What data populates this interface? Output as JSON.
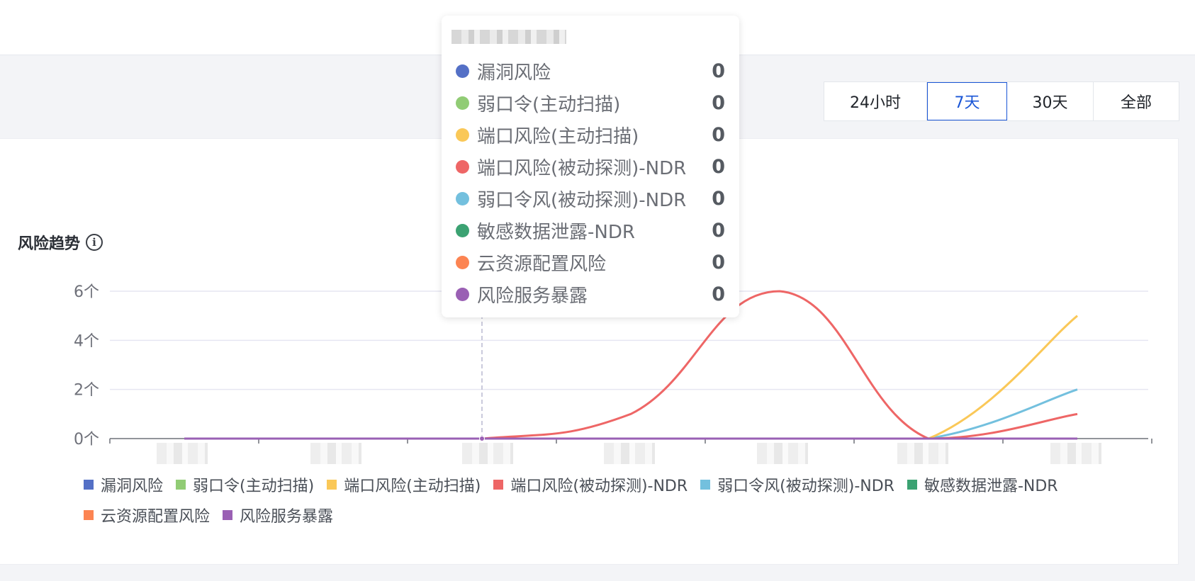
{
  "range_buttons": [
    {
      "label": "24小时",
      "active": false
    },
    {
      "label": "7天",
      "active": true
    },
    {
      "label": "30天",
      "active": false
    },
    {
      "label": "全部",
      "active": false
    }
  ],
  "chart_title": "风险趋势",
  "info_icon": "info-icon",
  "tooltip": {
    "rows": [
      {
        "label": "漏洞风险",
        "value": "0",
        "color": "#5470c6"
      },
      {
        "label": "弱口令(主动扫描)",
        "value": "0",
        "color": "#91cc75"
      },
      {
        "label": "端口风险(主动扫描)",
        "value": "0",
        "color": "#fac858"
      },
      {
        "label": "端口风险(被动探测)-NDR",
        "value": "0",
        "color": "#ee6666"
      },
      {
        "label": "弱口令风(被动探测)-NDR",
        "value": "0",
        "color": "#73c0de"
      },
      {
        "label": "敏感数据泄露-NDR",
        "value": "0",
        "color": "#3ba272"
      },
      {
        "label": "云资源配置风险",
        "value": "0",
        "color": "#fc8452"
      },
      {
        "label": "风险服务暴露",
        "value": "0",
        "color": "#9a60b4"
      }
    ]
  },
  "chart_data": {
    "type": "line",
    "smooth": true,
    "x_points": 7,
    "x_labels_obscured": true,
    "y_ticks": [
      "0个",
      "2个",
      "4个",
      "6个"
    ],
    "ylim": [
      0,
      6
    ],
    "grid": true,
    "legend_position": "bottom",
    "hover_index": 2,
    "series": [
      {
        "name": "漏洞风险",
        "color": "#5470c6",
        "values": [
          0,
          0,
          0,
          0,
          0,
          0,
          0
        ]
      },
      {
        "name": "弱口令(主动扫描)",
        "color": "#91cc75",
        "values": [
          0,
          0,
          0,
          0,
          0,
          0,
          0
        ]
      },
      {
        "name": "端口风险(主动扫描)",
        "color": "#fac858",
        "values": [
          0,
          0,
          0,
          0,
          0,
          0,
          5
        ]
      },
      {
        "name": "端口风险(被动探测)-NDR",
        "color": "#ee6666",
        "values": [
          0,
          0,
          0,
          1,
          6,
          0,
          1
        ]
      },
      {
        "name": "弱口令风(被动探测)-NDR",
        "color": "#73c0de",
        "values": [
          0,
          0,
          0,
          0,
          0,
          0,
          2
        ]
      },
      {
        "name": "敏感数据泄露-NDR",
        "color": "#3ba272",
        "values": [
          0,
          0,
          0,
          0,
          0,
          0,
          0
        ]
      },
      {
        "name": "云资源配置风险",
        "color": "#fc8452",
        "values": [
          0,
          0,
          0,
          0,
          0,
          0,
          0
        ]
      },
      {
        "name": "风险服务暴露",
        "color": "#9a60b4",
        "values": [
          0,
          0,
          0,
          0,
          0,
          0,
          0
        ]
      }
    ]
  }
}
